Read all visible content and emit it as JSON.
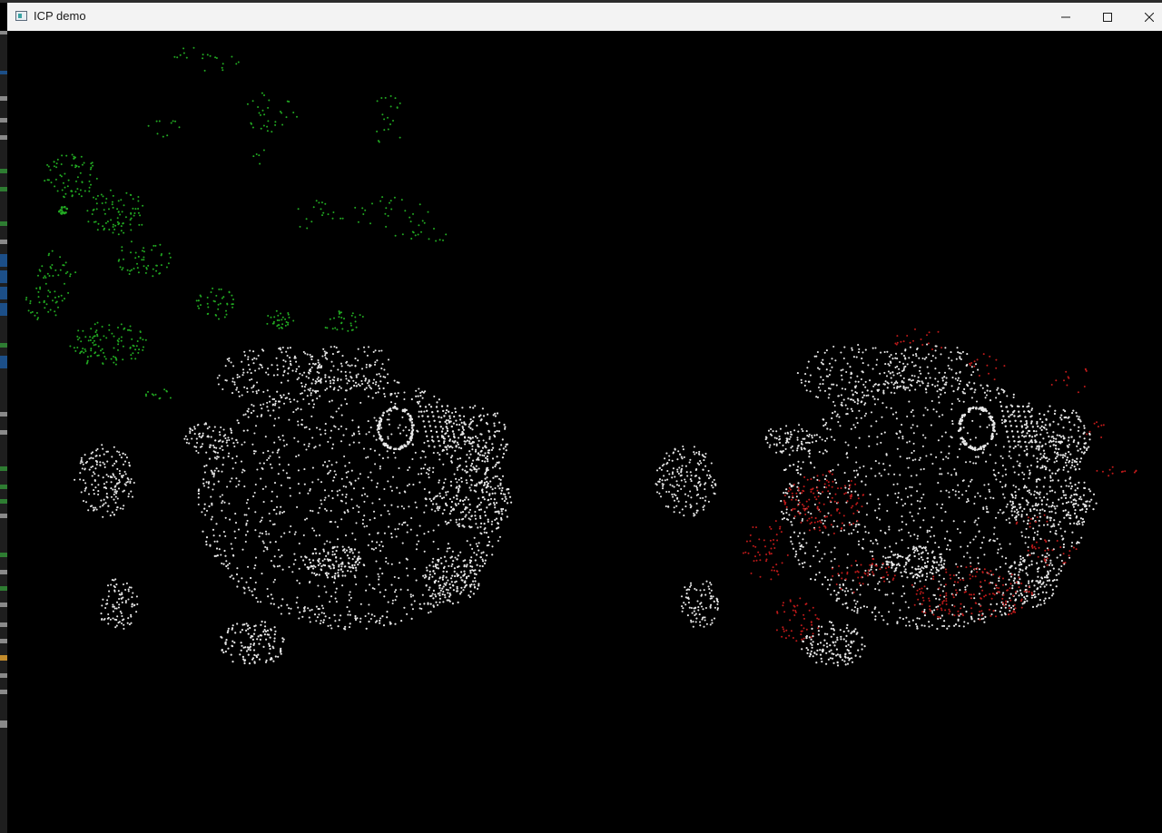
{
  "window": {
    "title": "ICP demo",
    "icon": "app-window-icon",
    "controls": {
      "minimize_icon": "minimize-icon",
      "maximize_icon": "maximize-icon",
      "close_icon": "close-icon"
    }
  },
  "viewport": {
    "background": "#000000",
    "panels": [
      {
        "side": "left",
        "clouds": [
          {
            "role": "target",
            "color": "#e6e6e6"
          },
          {
            "role": "source",
            "color": "#22aa22"
          }
        ]
      },
      {
        "side": "right",
        "clouds": [
          {
            "role": "target",
            "color": "#e6e6e6"
          },
          {
            "role": "aligned-source",
            "color": "#c01a1a"
          }
        ]
      }
    ]
  }
}
